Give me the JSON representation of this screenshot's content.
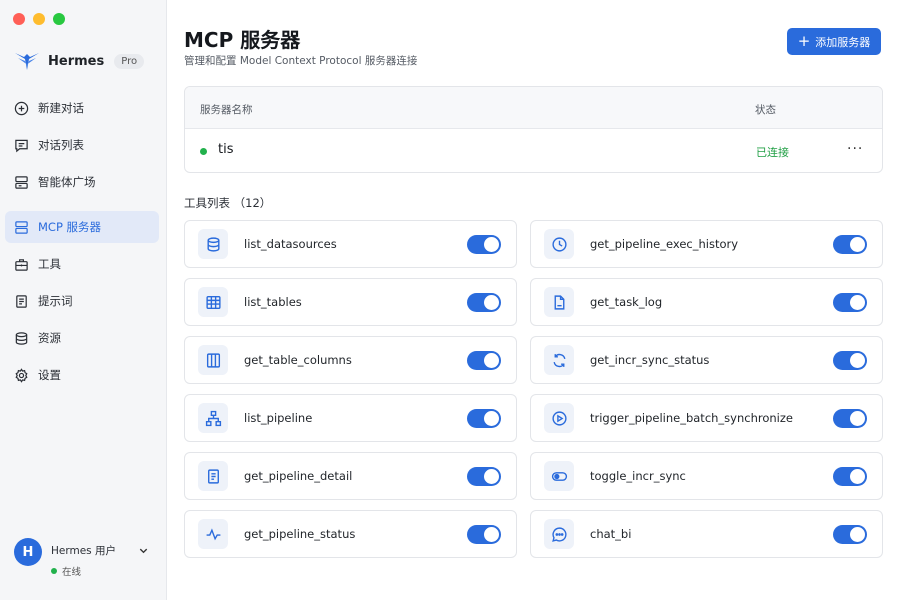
{
  "colors": {
    "accent": "#2a6bdc",
    "online": "#22b14c",
    "connected": "#22a046",
    "sidebar_bg": "#f5f6f8"
  },
  "brand": {
    "name": "Hermes",
    "badge": "Pro"
  },
  "nav": [
    {
      "label": "新建对话",
      "icon": "plus-circle-icon"
    },
    {
      "label": "对话列表",
      "icon": "chat-list-icon"
    },
    {
      "label": "智能体广场",
      "icon": "agent-store-icon"
    },
    {
      "label": "MCP 服务器",
      "icon": "server-icon",
      "active": true
    },
    {
      "label": "工具",
      "icon": "toolbox-icon"
    },
    {
      "label": "提示词",
      "icon": "prompt-doc-icon"
    },
    {
      "label": "资源",
      "icon": "database-icon"
    },
    {
      "label": "设置",
      "icon": "gear-icon"
    }
  ],
  "user": {
    "avatar_letter": "H",
    "name": "Hermes 用户",
    "status": "在线"
  },
  "header": {
    "title": "MCP 服务器",
    "subtitle": "管理和配置 Model Context Protocol 服务器连接",
    "add_button": "添加服务器"
  },
  "servers": {
    "columns": {
      "name": "服务器名称",
      "status": "状态"
    },
    "rows": [
      {
        "name": "tis",
        "status": "已连接",
        "more": "···"
      }
    ]
  },
  "tools": {
    "title": "工具列表 （12）",
    "items": [
      {
        "name": "list_datasources",
        "icon": "database-icon",
        "enabled": true
      },
      {
        "name": "get_pipeline_exec_history",
        "icon": "clock-icon",
        "enabled": true
      },
      {
        "name": "list_tables",
        "icon": "table-icon",
        "enabled": true
      },
      {
        "name": "get_task_log",
        "icon": "file-icon",
        "enabled": true
      },
      {
        "name": "get_table_columns",
        "icon": "columns-icon",
        "enabled": true
      },
      {
        "name": "get_incr_sync_status",
        "icon": "refresh-icon",
        "enabled": true
      },
      {
        "name": "list_pipeline",
        "icon": "hierarchy-icon",
        "enabled": true
      },
      {
        "name": "trigger_pipeline_batch_synchronize",
        "icon": "play-circle-icon",
        "enabled": true
      },
      {
        "name": "get_pipeline_detail",
        "icon": "document-icon",
        "enabled": true
      },
      {
        "name": "toggle_incr_sync",
        "icon": "toggle-icon",
        "enabled": true
      },
      {
        "name": "get_pipeline_status",
        "icon": "activity-icon",
        "enabled": true
      },
      {
        "name": "chat_bi",
        "icon": "chat-bubble-icon",
        "enabled": true
      }
    ]
  }
}
